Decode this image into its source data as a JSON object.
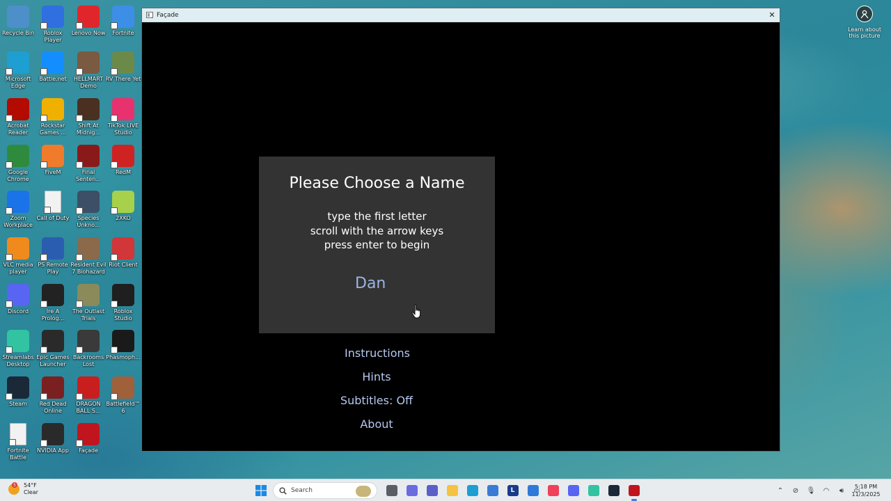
{
  "desktop": {
    "icons": [
      {
        "label": "Recycle Bin",
        "icon": "recycle-bin-icon",
        "color": "#4d8fc9"
      },
      {
        "label": "Roblox Player",
        "icon": "roblox-icon",
        "color": "#2f6fe0"
      },
      {
        "label": "Lenovo Now",
        "icon": "lenovo-icon",
        "color": "#e0262b"
      },
      {
        "label": "Fortnite",
        "icon": "fortnite-icon",
        "color": "#3c8ee6"
      },
      {
        "label": "Microsoft Edge",
        "icon": "edge-icon",
        "color": "#1d9fd1"
      },
      {
        "label": "Battle.net",
        "icon": "battlenet-icon",
        "color": "#148eff"
      },
      {
        "label": "HELLMART Demo",
        "icon": "hellmart-icon",
        "color": "#7a5a40"
      },
      {
        "label": "RV There Yet",
        "icon": "rv-icon",
        "color": "#6b8a4a"
      },
      {
        "label": "Acrobat Reader",
        "icon": "acrobat-icon",
        "color": "#b30b00"
      },
      {
        "label": "Rockstar Games ...",
        "icon": "rockstar-icon",
        "color": "#f0b000"
      },
      {
        "label": "Shift At Midnig...",
        "icon": "shift-at-midnight-icon",
        "color": "#4a3020"
      },
      {
        "label": "TikTok LIVE Studio",
        "icon": "tiktok-icon",
        "color": "#e7326f"
      },
      {
        "label": "Google Chrome",
        "icon": "chrome-icon",
        "color": "#2e8b3e"
      },
      {
        "label": "FiveM",
        "icon": "fivem-icon",
        "color": "#f07b2a"
      },
      {
        "label": "Final Senten...",
        "icon": "final-sentence-icon",
        "color": "#8a1a1a"
      },
      {
        "label": "RedM",
        "icon": "redm-icon",
        "color": "#cf2323"
      },
      {
        "label": "Zoom Workplace",
        "icon": "zoom-icon",
        "color": "#1a73e8"
      },
      {
        "label": "Call of Duty",
        "icon": "file-icon",
        "color": "#f2f2f2"
      },
      {
        "label": "Species Unkno...",
        "icon": "species-unknown-icon",
        "color": "#3d4f66"
      },
      {
        "label": "2XKO",
        "icon": "2xko-icon",
        "color": "#a7d14a"
      },
      {
        "label": "VLC media player",
        "icon": "vlc-icon",
        "color": "#f08a1c"
      },
      {
        "label": "PS Remote Play",
        "icon": "ps-remote-play-icon",
        "color": "#2a5db0"
      },
      {
        "label": "Resident Evil 7 Biohazard",
        "icon": "resident-evil-icon",
        "color": "#8a6a4a"
      },
      {
        "label": "Riot Client",
        "icon": "riot-icon",
        "color": "#d13639"
      },
      {
        "label": "Discord",
        "icon": "discord-icon",
        "color": "#5865f2"
      },
      {
        "label": "Ire A Prolog...",
        "icon": "ire-icon",
        "color": "#222222"
      },
      {
        "label": "The Outlast Trials",
        "icon": "outlast-icon",
        "color": "#8a8a5a"
      },
      {
        "label": "Roblox Studio",
        "icon": "roblox-studio-icon",
        "color": "#1f1f1f"
      },
      {
        "label": "Streamlabs Desktop",
        "icon": "streamlabs-icon",
        "color": "#31c3a2"
      },
      {
        "label": "Epic Games Launcher",
        "icon": "epic-games-icon",
        "color": "#2a2a2a"
      },
      {
        "label": "Backrooms Lost Runne...",
        "icon": "backrooms-icon",
        "color": "#3a3a3a"
      },
      {
        "label": "Phasmoph...",
        "icon": "phasmophobia-icon",
        "color": "#1a1a1a"
      },
      {
        "label": "Steam",
        "icon": "steam-icon",
        "color": "#1b2838"
      },
      {
        "label": "Red Dead Online",
        "icon": "red-dead-icon",
        "color": "#7a2020"
      },
      {
        "label": "DRAGON BALL S...",
        "icon": "dragon-ball-icon",
        "color": "#c81e1e"
      },
      {
        "label": "Battlefield™ 6",
        "icon": "battlefield-icon",
        "color": "#a0603a"
      },
      {
        "label": "Fortnite Battle Royale",
        "icon": "file-icon",
        "color": "#f2f2f2"
      },
      {
        "label": "NVIDIA App",
        "icon": "nvidia-icon",
        "color": "#2a2a2a"
      },
      {
        "label": "Façade",
        "icon": "facade-icon",
        "color": "#c0151e"
      }
    ],
    "learn_label": "Learn about this picture"
  },
  "window": {
    "title": "Façade",
    "close_glyph": "✕"
  },
  "game": {
    "panel_title": "Please Choose a Name",
    "instructions": [
      "type the first letter",
      "scroll with the arrow keys",
      "press enter to begin"
    ],
    "name_value": "Dan",
    "menu": {
      "instructions": "Instructions",
      "hints": "Hints",
      "subtitles": "Subtitles: Off",
      "about": "About"
    },
    "colors": {
      "panel": "#333333",
      "name": "#9bb4e4",
      "menu": "#b5c8ef"
    }
  },
  "taskbar": {
    "weather_temp": "54°F",
    "weather_cond": "Clear",
    "search_placeholder": "Search",
    "time": "5:18 PM",
    "date": "11/3/2025",
    "apps": [
      {
        "icon": "task-view-icon",
        "color": "#5a5f66",
        "text": ""
      },
      {
        "icon": "copilot-icon",
        "color": "#6b6be0",
        "text": ""
      },
      {
        "icon": "teams-icon",
        "color": "#5b5fc7",
        "text": ""
      },
      {
        "icon": "file-explorer-icon",
        "color": "#f5c242",
        "text": ""
      },
      {
        "icon": "edge-icon",
        "color": "#1d9fd1",
        "text": ""
      },
      {
        "icon": "microsoft-store-icon",
        "color": "#3a7bd5",
        "text": ""
      },
      {
        "icon": "lenovo-l-icon",
        "color": "#1a3a8a",
        "text": "L"
      },
      {
        "icon": "app-pen-icon",
        "color": "#2f7ad8",
        "text": ""
      },
      {
        "icon": "apple-music-icon",
        "color": "#f0405a",
        "text": ""
      },
      {
        "icon": "discord-icon",
        "color": "#5865f2",
        "text": ""
      },
      {
        "icon": "streamlabs-icon",
        "color": "#31c3a2",
        "text": ""
      },
      {
        "icon": "steam-icon",
        "color": "#1b2838",
        "text": ""
      },
      {
        "icon": "facade-icon",
        "color": "#c0151e",
        "text": ""
      }
    ]
  }
}
